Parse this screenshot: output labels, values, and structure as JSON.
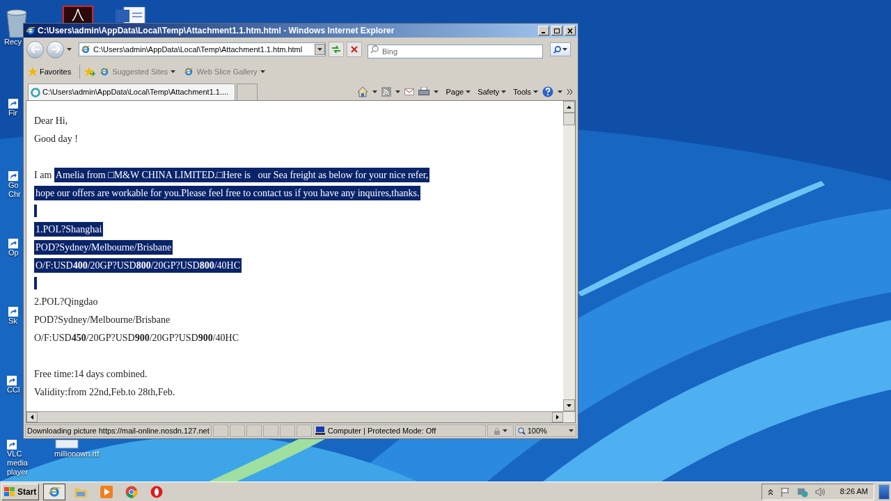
{
  "desktop": {
    "icons": [
      {
        "label": "Recy",
        "kind": "bin"
      },
      {
        "label": "Fir",
        "kind": "shortcut"
      },
      {
        "label": "Go Chr",
        "kind": "shortcut"
      },
      {
        "label": "Op",
        "kind": "shortcut"
      },
      {
        "label": "Sk",
        "kind": "shortcut"
      },
      {
        "label": "CCl",
        "kind": "shortcut"
      },
      {
        "label": "VLC media player",
        "kind": "shortcut"
      },
      {
        "label": "millionown.rtf",
        "kind": "file"
      }
    ]
  },
  "window": {
    "title": "C:\\Users\\admin\\AppData\\Local\\Temp\\Attachment1.1.htm.html - Windows Internet Explorer"
  },
  "address_bar": {
    "value": "C:\\Users\\admin\\AppData\\Local\\Temp\\Attachment1.1.htm.html"
  },
  "search": {
    "placeholder": "Bing"
  },
  "favorites_bar": {
    "favorites": "Favorites",
    "items": [
      "Suggested Sites",
      "Web Slice Gallery"
    ]
  },
  "tabs": [
    {
      "label": "C:\\Users\\admin\\AppData\\Local\\Temp\\Attachment1.1....",
      "selected": true
    }
  ],
  "command_bar": [
    "Page",
    "Safety",
    "Tools"
  ],
  "document": {
    "lines": [
      {
        "kind": "text",
        "segments": [
          {
            "text": "Dear Hi,",
            "selected": false
          }
        ]
      },
      {
        "kind": "text",
        "segments": [
          {
            "text": "Good day !",
            "selected": false
          }
        ]
      },
      {
        "kind": "gap"
      },
      {
        "kind": "text",
        "segments": [
          {
            "text": "I am ",
            "selected": false
          },
          {
            "text": "Amelia from □M&W CHINA LIMITED.□Here is   our Sea freight as below for your nice refer,",
            "selected": true
          }
        ]
      },
      {
        "kind": "text",
        "segments": [
          {
            "text": "hope our offers are workable for you.Please feel free to contact us if you have any inquires,thanks.",
            "selected": true
          }
        ]
      },
      {
        "kind": "bar",
        "selected": true
      },
      {
        "kind": "text",
        "segments": [
          {
            "text": "1.POL?Shanghai",
            "selected": true
          }
        ]
      },
      {
        "kind": "text",
        "segments": [
          {
            "text": "POD?Sydney/Melbourne/Brisbane",
            "selected": true
          }
        ]
      },
      {
        "kind": "text",
        "segments": [
          {
            "text": "O/F:USD**400**/20GP?USD**800**/20GP?USD**800**/40HC",
            "selected": true
          }
        ]
      },
      {
        "kind": "bar",
        "selected": true
      },
      {
        "kind": "text",
        "segments": [
          {
            "text": "2.POL?Qingdao",
            "selected": false
          }
        ]
      },
      {
        "kind": "text",
        "segments": [
          {
            "text": "POD?Sydney/Melbourne/Brisbane",
            "selected": false
          }
        ]
      },
      {
        "kind": "text",
        "segments": [
          {
            "text": "O/F:USD**450**/20GP?USD**900**/20GP?USD**900**/40HC",
            "selected": false
          }
        ]
      },
      {
        "kind": "gap"
      },
      {
        "kind": "text",
        "segments": [
          {
            "text": "Free time:14 days combined.",
            "selected": false
          }
        ]
      },
      {
        "kind": "text",
        "segments": [
          {
            "text": "Validity:from 22nd,Feb.to 28th,Feb.",
            "selected": false
          }
        ]
      }
    ]
  },
  "status_bar": {
    "text": "Downloading picture https://mail-online.nosdn.127.net",
    "zone": "Computer | Protected Mode: Off",
    "zoom": "100%"
  },
  "taskbar": {
    "start": "Start",
    "time": "8:26 AM"
  }
}
